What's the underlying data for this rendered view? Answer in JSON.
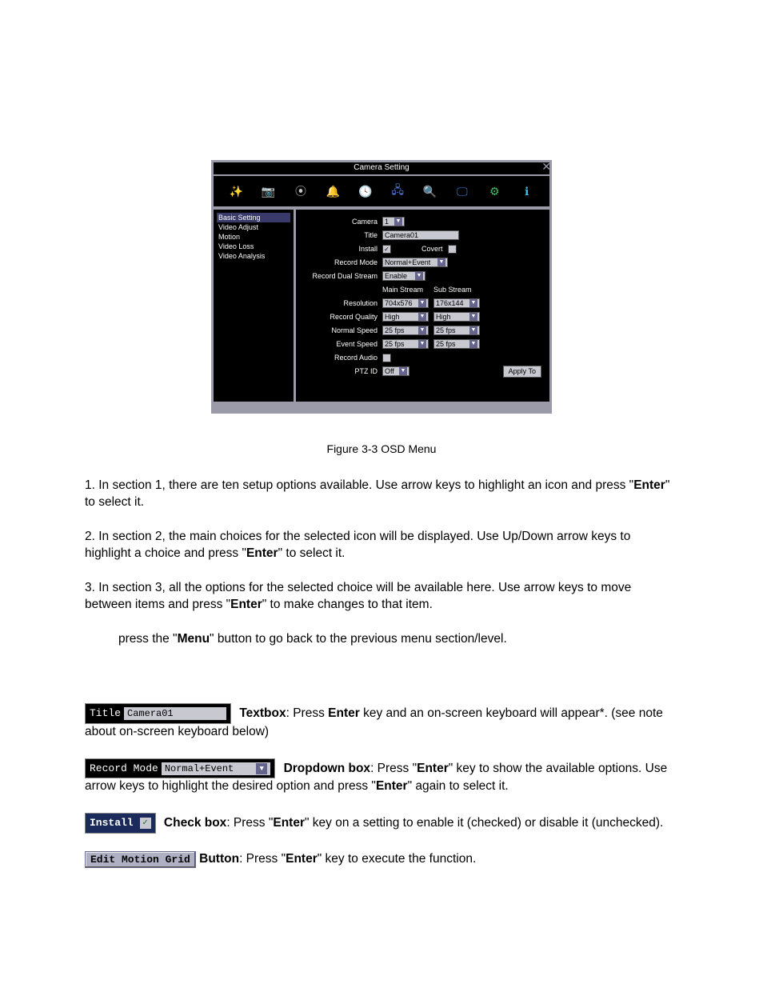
{
  "osd": {
    "title": "Camera Setting",
    "close_glyph": "✕",
    "toolbar_icons": [
      {
        "name": "wand-icon",
        "glyph": "✨",
        "color": "#d8a040"
      },
      {
        "name": "camera-icon",
        "glyph": "📷",
        "color": "#c8c8c8"
      },
      {
        "name": "reel-icon",
        "glyph": "⦿",
        "color": "#c8c8c8"
      },
      {
        "name": "bell-icon",
        "glyph": "🔔",
        "color": "#e8c040"
      },
      {
        "name": "clock-icon",
        "glyph": "🕓",
        "color": "#40c060"
      },
      {
        "name": "network-icon",
        "glyph": "🖧",
        "color": "#5080e0"
      },
      {
        "name": "search-icon",
        "glyph": "🔍",
        "color": "#d0b040"
      },
      {
        "name": "display-icon",
        "glyph": "🖵",
        "color": "#4080e0"
      },
      {
        "name": "gear-icon",
        "glyph": "⚙",
        "color": "#40c060"
      },
      {
        "name": "info-icon",
        "glyph": "ℹ",
        "color": "#40c0e0"
      }
    ],
    "side_items": [
      "Basic Setting",
      "Video Adjust",
      "Motion",
      "Video Loss",
      "Video Analysis"
    ],
    "side_selected_index": 0,
    "form": {
      "camera_label": "Camera",
      "camera_value": "1",
      "title_label": "Title",
      "title_value": "Camera01",
      "install_label": "Install",
      "install_checked": true,
      "covert_label": "Covert",
      "covert_checked": false,
      "record_mode_label": "Record Mode",
      "record_mode_value": "Normal+Event",
      "dual_stream_label": "Record Dual Stream",
      "dual_stream_value": "Enable",
      "main_stream_header": "Main Stream",
      "sub_stream_header": "Sub Stream",
      "resolution_label": "Resolution",
      "resolution_main": "704x576",
      "resolution_sub": "176x144",
      "quality_label": "Record Quality",
      "quality_main": "High",
      "quality_sub": "High",
      "normal_speed_label": "Normal Speed",
      "normal_speed_main": "25 fps",
      "normal_speed_sub": "25 fps",
      "event_speed_label": "Event Speed",
      "event_speed_main": "25 fps",
      "event_speed_sub": "25 fps",
      "record_audio_label": "Record Audio",
      "record_audio_checked": false,
      "ptz_id_label": "PTZ ID",
      "ptz_id_value": "Off",
      "apply_to_label": "Apply To"
    }
  },
  "caption": "Figure 3-3 OSD Menu",
  "doc": {
    "p1_a": "1. In section 1, there are ten setup options available. Use arrow keys to highlight an icon and press \"",
    "p1_b": "Enter",
    "p1_c": "\" to select it.",
    "p2_a": "2. In section 2, the main choices for the selected icon will be displayed. Use Up/Down arrow keys to highlight a choice and press \"",
    "p2_b": "Enter",
    "p2_c": "\" to select it.",
    "p3_a": "3. In section 3, all the options for the selected choice will be available here. Use arrow keys to move between items and press \"",
    "p3_b": "Enter",
    "p3_c": "\" to make changes to that item.",
    "p4_a": "press the \"",
    "p4_b": "Menu",
    "p4_c": "\" button to go back to the previous menu section/level.",
    "ex_textbox_label": "Title",
    "ex_textbox_value": "Camera01",
    "ex_textbox_name": "Textbox",
    "ex_textbox_a": ": Press ",
    "ex_textbox_b": "Enter",
    "ex_textbox_c": " key and an on-screen keyboard will appear*. (see note about on-screen keyboard below)",
    "ex_dd_label": "Record Mode",
    "ex_dd_value": "Normal+Event",
    "ex_dd_name": "Dropdown box",
    "ex_dd_a": ": Press \"",
    "ex_dd_b": "Enter",
    "ex_dd_c": "\" key to show the available options. Use arrow keys to highlight the desired option and press \"",
    "ex_dd_d": "Enter",
    "ex_dd_e": "\" again to select it.",
    "ex_chk_label": "Install",
    "ex_chk_name": "Check box",
    "ex_chk_a": ": Press \"",
    "ex_chk_b": "Enter",
    "ex_chk_c": "\" key on a setting to enable it (checked) or disable it (unchecked).",
    "ex_btn_label": "Edit Motion Grid",
    "ex_btn_name": "Button",
    "ex_btn_a": ": Press \"",
    "ex_btn_b": "Enter",
    "ex_btn_c": "\" key to execute the function."
  }
}
